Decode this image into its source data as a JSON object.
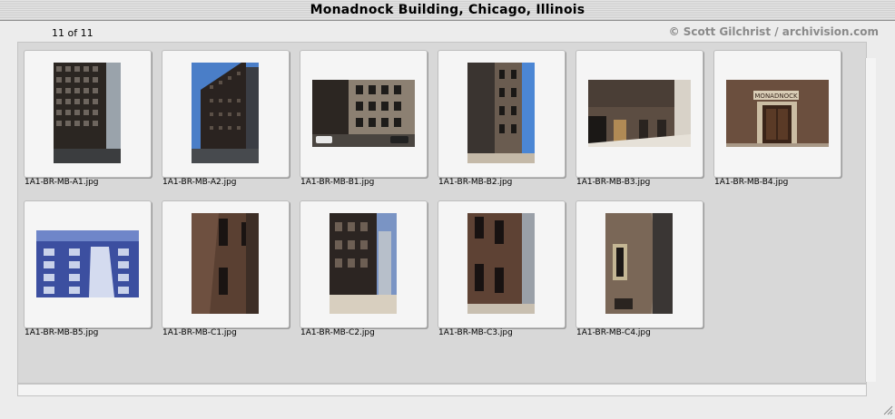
{
  "window": {
    "title": "Monadnock Building, Chicago, Illinois"
  },
  "toolbar": {
    "counter": "11 of 11",
    "credit": "© Scott Gilchrist / archivision.com"
  },
  "thumbnails": [
    {
      "filename": "1A1-BR-MB-A1.jpg",
      "image": "tall-building-street-photo"
    },
    {
      "filename": "1A1-BR-MB-A2.jpg",
      "image": "tall-building-sky-photo"
    },
    {
      "filename": "1A1-BR-MB-B1.jpg",
      "image": "building-facade-street-photo"
    },
    {
      "filename": "1A1-BR-MB-B2.jpg",
      "image": "building-corner-photo"
    },
    {
      "filename": "1A1-BR-MB-B3.jpg",
      "image": "building-base-photo"
    },
    {
      "filename": "1A1-BR-MB-B4.jpg",
      "image": "entrance-sign-photo"
    },
    {
      "filename": "1A1-BR-MB-B5.jpg",
      "image": "bay-windows-photo"
    },
    {
      "filename": "1A1-BR-MB-C1.jpg",
      "image": "brick-wall-photo"
    },
    {
      "filename": "1A1-BR-MB-C2.jpg",
      "image": "street-view-photo"
    },
    {
      "filename": "1A1-BR-MB-C3.jpg",
      "image": "brick-wall-photo"
    },
    {
      "filename": "1A1-BR-MB-C4.jpg",
      "image": "curved-wall-photo"
    }
  ]
}
